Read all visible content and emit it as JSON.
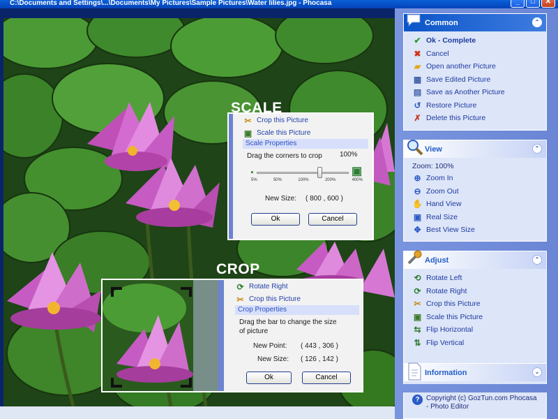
{
  "window": {
    "title": "C:\\Documents and Settings\\...\\Documents\\My Pictures\\Sample Pictures\\Water lilies.jpg - Phocasa"
  },
  "overlay_labels": {
    "scale": "SCALE",
    "crop": "CROP"
  },
  "scale_dialog": {
    "crop_link": "Crop this Picture",
    "scale_link": "Scale this Picture",
    "section": "Scale Properties",
    "hint": "Drag the corners to crop",
    "percent": "100%",
    "ticks": [
      "5%",
      "50%",
      "100%",
      "200%",
      "400%"
    ],
    "slider_value": 100,
    "new_size_label": "New Size:",
    "new_size_value": "( 800 , 600 )",
    "ok": "Ok",
    "cancel": "Cancel"
  },
  "crop_dialog": {
    "rotate_link": "Rotate Right",
    "crop_link": "Crop this Picture",
    "section": "Crop Properties",
    "hint_line1": "Drag the bar to change the size",
    "hint_line2": "of picture",
    "new_point_label": "New Point:",
    "new_point_value": "( 443 , 306 )",
    "new_size_label": "New Size:",
    "new_size_value": "( 126 , 142 )",
    "ok": "Ok",
    "cancel": "Cancel"
  },
  "sidebar": {
    "common": {
      "title": "Common",
      "items": [
        {
          "label": "Ok - Complete",
          "icon": "check-icon"
        },
        {
          "label": "Cancel",
          "icon": "x-icon"
        },
        {
          "label": "Open another Picture",
          "icon": "folder-open-icon"
        },
        {
          "label": "Save Edited Picture",
          "icon": "save-icon"
        },
        {
          "label": "Save as Another Picture",
          "icon": "save-as-icon"
        },
        {
          "label": "Restore Picture",
          "icon": "restore-icon"
        },
        {
          "label": "Delete this Picture",
          "icon": "delete-icon"
        }
      ]
    },
    "view": {
      "title": "View",
      "zoom_text": "Zoom: 100%",
      "items": [
        {
          "label": "Zoom In",
          "icon": "zoom-in-icon"
        },
        {
          "label": "Zoom Out",
          "icon": "zoom-out-icon"
        },
        {
          "label": "Hand View",
          "icon": "hand-icon"
        },
        {
          "label": "Real Size",
          "icon": "real-size-icon"
        },
        {
          "label": "Best View Size",
          "icon": "best-fit-icon"
        }
      ]
    },
    "adjust": {
      "title": "Adjust",
      "items": [
        {
          "label": "Rotate Left",
          "icon": "rotate-left-icon"
        },
        {
          "label": "Rotate Right",
          "icon": "rotate-right-icon"
        },
        {
          "label": "Crop this Picture",
          "icon": "crop-icon"
        },
        {
          "label": "Scale this Picture",
          "icon": "scale-icon"
        },
        {
          "label": "Flip Horizontal",
          "icon": "flip-horizontal-icon"
        },
        {
          "label": "Flip Vertical",
          "icon": "flip-vertical-icon"
        }
      ]
    },
    "information": {
      "title": "Information",
      "copyright_line1": "Copyright (c) GozTun.com Phocasa",
      "copyright_line2": "- Photo Editor"
    }
  }
}
